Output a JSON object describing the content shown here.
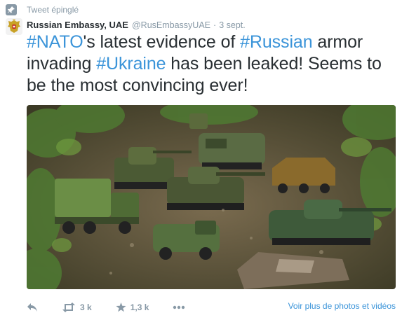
{
  "pinned": {
    "label": "Tweet épinglé",
    "icon": "pin-icon"
  },
  "author": {
    "name": "Russian Embassy, UAE",
    "handle": "@RusEmbassyUAE",
    "separator": "·",
    "date": "3 sept.",
    "avatar_icon": "coat-of-arms-avatar"
  },
  "tweet": {
    "segments": [
      {
        "text": "#NATO",
        "hashtag": true
      },
      {
        "text": "'s latest evidence of ",
        "hashtag": false
      },
      {
        "text": "#Russian",
        "hashtag": true
      },
      {
        "text": " armor invading ",
        "hashtag": false
      },
      {
        "text": "#Ukraine",
        "hashtag": true
      },
      {
        "text": " has been leaked! Seems to be the most convincing ever!",
        "hashtag": false
      }
    ]
  },
  "media": {
    "description_icon": "toy-military-vehicles-photo"
  },
  "actions": {
    "reply_icon": "reply-icon",
    "retweet_icon": "retweet-icon",
    "retweet_count": "3 k",
    "favorite_icon": "star-icon",
    "favorite_count": "1,3 k",
    "more_icon": "more-icon",
    "more_photos_label": "Voir plus de photos et vidéos"
  },
  "colors": {
    "hashtag": "#3b94d9",
    "muted": "#8899a6",
    "text": "#292f33"
  }
}
